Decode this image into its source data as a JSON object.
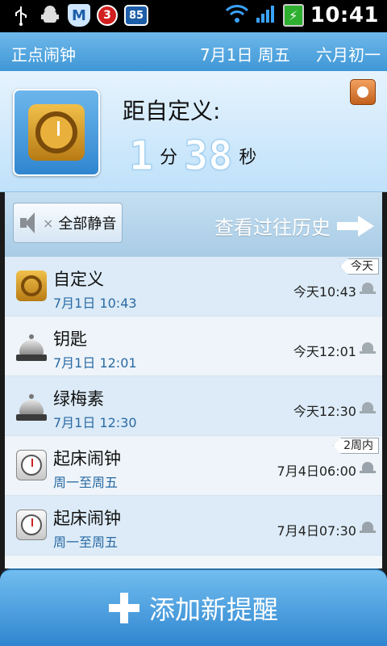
{
  "statusbar": {
    "badge1": "3",
    "badge2": "85",
    "shield_letter": "M",
    "time": "10:41"
  },
  "header": {
    "app_title": "正点闹钟",
    "date": "7月1日 周五",
    "lunar": "六月初一"
  },
  "countdown": {
    "label": "距自定义:",
    "minutes": "1",
    "minutes_unit": "分",
    "seconds": "38",
    "seconds_unit": "秒"
  },
  "toolbar": {
    "mute_label": "全部静音",
    "mute_x": "×",
    "history_label": "查看过往历史"
  },
  "tags": {
    "today": "今天",
    "within_two_weeks": "2周内"
  },
  "alarms": [
    {
      "title": "自定义",
      "sub": "7月1日 10:43",
      "when": "今天10:43",
      "icon": "gear-icon",
      "muted": true
    },
    {
      "title": "钥匙",
      "sub": "7月1日 12:01",
      "when": "今天12:01",
      "icon": "bell-icon",
      "muted": true
    },
    {
      "title": "绿梅素",
      "sub": "7月1日 12:30",
      "when": "今天12:30",
      "icon": "bell-icon",
      "muted": true
    },
    {
      "title": "起床闹钟",
      "sub": "周一至周五",
      "when": "7月4日06:00",
      "icon": "clock-icon",
      "muted": false
    },
    {
      "title": "起床闹钟",
      "sub": "周一至周五",
      "when": "7月4日07:30",
      "icon": "clock-icon",
      "muted": false
    }
  ],
  "bottom": {
    "add_label": "添加新提醒"
  },
  "colors": {
    "accent": "#3f97d6",
    "list_highlight": "#dcebf7",
    "date_text": "#2a6aa3"
  }
}
